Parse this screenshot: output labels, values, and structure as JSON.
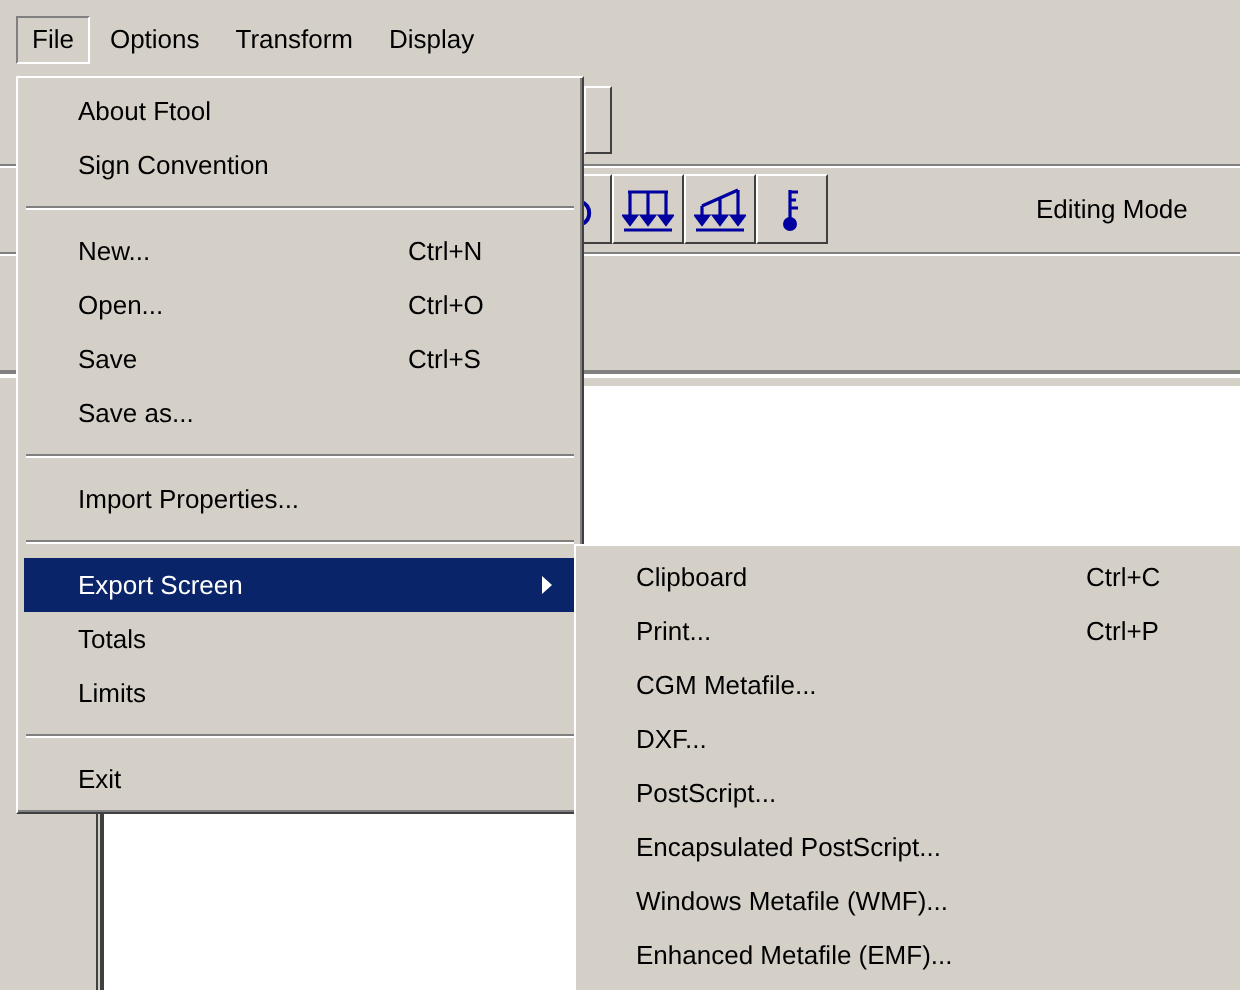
{
  "menubar": [
    {
      "label": "File",
      "selected": true
    },
    {
      "label": "Options",
      "selected": false
    },
    {
      "label": "Transform",
      "selected": false
    },
    {
      "label": "Display",
      "selected": false
    }
  ],
  "toolbar": {
    "status_label": "Editing Mode"
  },
  "file_menu": [
    {
      "kind": "item",
      "label": "About Ftool",
      "selected": false
    },
    {
      "kind": "item",
      "label": "Sign Convention",
      "selected": false
    },
    {
      "kind": "separator"
    },
    {
      "kind": "item",
      "label": "New...",
      "shortcut": "Ctrl+N",
      "selected": false
    },
    {
      "kind": "item",
      "label": "Open...",
      "shortcut": "Ctrl+O",
      "selected": false
    },
    {
      "kind": "item",
      "label": "Save",
      "shortcut": "Ctrl+S",
      "selected": false
    },
    {
      "kind": "item",
      "label": "Save as...",
      "selected": false
    },
    {
      "kind": "separator"
    },
    {
      "kind": "item",
      "label": "Import Properties...",
      "selected": false
    },
    {
      "kind": "separator"
    },
    {
      "kind": "submenu",
      "label": "Export Screen",
      "selected": true
    },
    {
      "kind": "item",
      "label": "Totals",
      "selected": false
    },
    {
      "kind": "item",
      "label": "Limits",
      "selected": false
    },
    {
      "kind": "separator"
    },
    {
      "kind": "item",
      "label": "Exit",
      "selected": false
    }
  ],
  "export_submenu": [
    {
      "label": "Clipboard",
      "shortcut": "Ctrl+C"
    },
    {
      "label": "Print...",
      "shortcut": "Ctrl+P"
    },
    {
      "label": "CGM Metafile..."
    },
    {
      "label": "DXF..."
    },
    {
      "label": "PostScript..."
    },
    {
      "label": "Encapsulated PostScript..."
    },
    {
      "label": "Windows Metafile (WMF)..."
    },
    {
      "label": "Enhanced Metafile (EMF)..."
    }
  ]
}
